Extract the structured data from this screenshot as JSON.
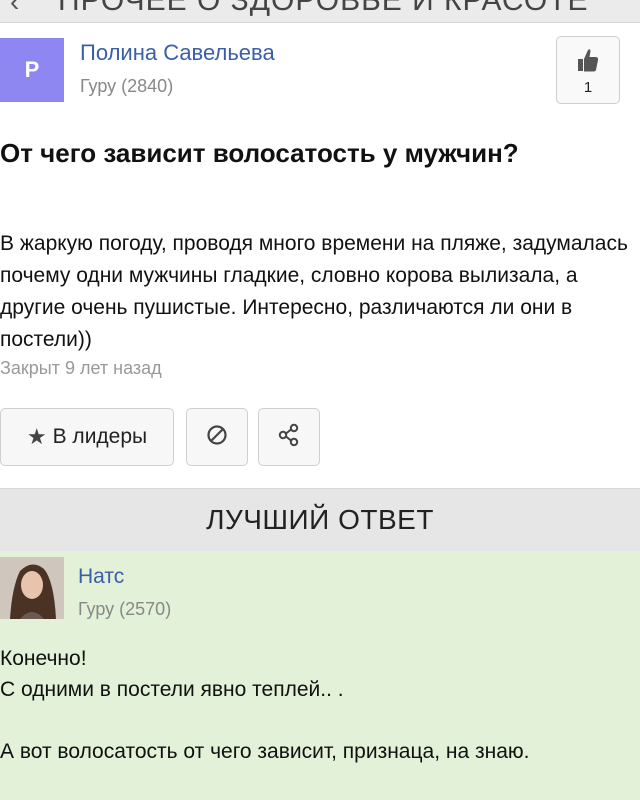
{
  "header": {
    "back_icon": "chevron-left-icon",
    "title": "ПРОЧЕЕ О ЗДОРОВЬЕ И КРАСОТЕ"
  },
  "asker": {
    "avatar_letter": "P",
    "name": "Полина Савельева",
    "rank": "Гуру (2840)"
  },
  "like": {
    "icon": "thumbs-up-icon",
    "count": "1"
  },
  "question": {
    "title": "От чего зависит волосатость у мужчин?",
    "body": "В жаркую погоду, проводя много времени на пляже, задумалась почему одни мужчины гладкие, словно корова вылизала, а другие очень пушистые. Интересно, различаются ли они в постели))",
    "closed": "Закрыт 9 лет назад"
  },
  "actions": {
    "leaders_label": "В лидеры",
    "star_icon": "star-icon",
    "block_icon": "block-icon",
    "share_icon": "share-icon"
  },
  "best_answer": {
    "header": "ЛУЧШИЙ ОТВЕТ",
    "name": "Натс",
    "rank": "Гуру (2570)",
    "lines": [
      "Конечно!",
      "С одними в постели явно теплей.. .",
      "",
      "А вот волосатость от чего зависит, признаца, на знаю."
    ]
  },
  "colors": {
    "link": "#3a5ea8",
    "avatar_bg": "#8e86f1",
    "answer_bg": "#e2f1d8",
    "header_bg": "#e6e6e6"
  }
}
